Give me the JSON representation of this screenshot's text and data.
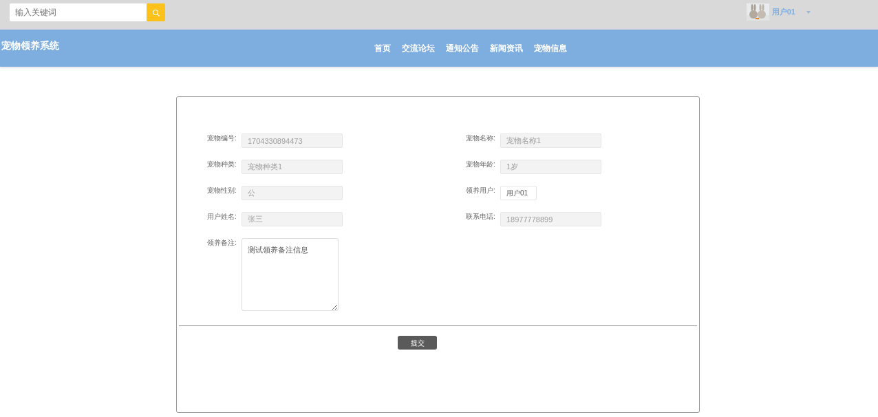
{
  "search": {
    "placeholder": "输入关键词"
  },
  "user": {
    "name": "用户01"
  },
  "brand": "宠物领养系统",
  "nav": [
    {
      "label": "首页"
    },
    {
      "label": "交流论坛"
    },
    {
      "label": "通知公告"
    },
    {
      "label": "新闻资讯"
    },
    {
      "label": "宠物信息"
    }
  ],
  "form": {
    "fields": [
      {
        "label": "宠物编号:",
        "value": "1704330894473",
        "kind": "text",
        "disabled": true
      },
      {
        "label": "宠物名称:",
        "value": "宠物名称1",
        "kind": "text",
        "disabled": true
      },
      {
        "label": "宠物种类:",
        "value": "宠物种类1",
        "kind": "text",
        "disabled": true
      },
      {
        "label": "宠物年龄:",
        "value": "1岁",
        "kind": "text",
        "disabled": true
      },
      {
        "label": "宠物性别:",
        "value": "公",
        "kind": "text",
        "disabled": true
      },
      {
        "label": "领养用户:",
        "value": "用户01",
        "kind": "short",
        "disabled": false
      },
      {
        "label": "用户姓名:",
        "value": "张三",
        "kind": "text",
        "disabled": true
      },
      {
        "label": "联系电话:",
        "value": "18977778899",
        "kind": "text",
        "disabled": true
      },
      {
        "label": "领养备注:",
        "value": "测试领养备注信息",
        "kind": "textarea",
        "disabled": false
      }
    ],
    "submit": "提交"
  }
}
